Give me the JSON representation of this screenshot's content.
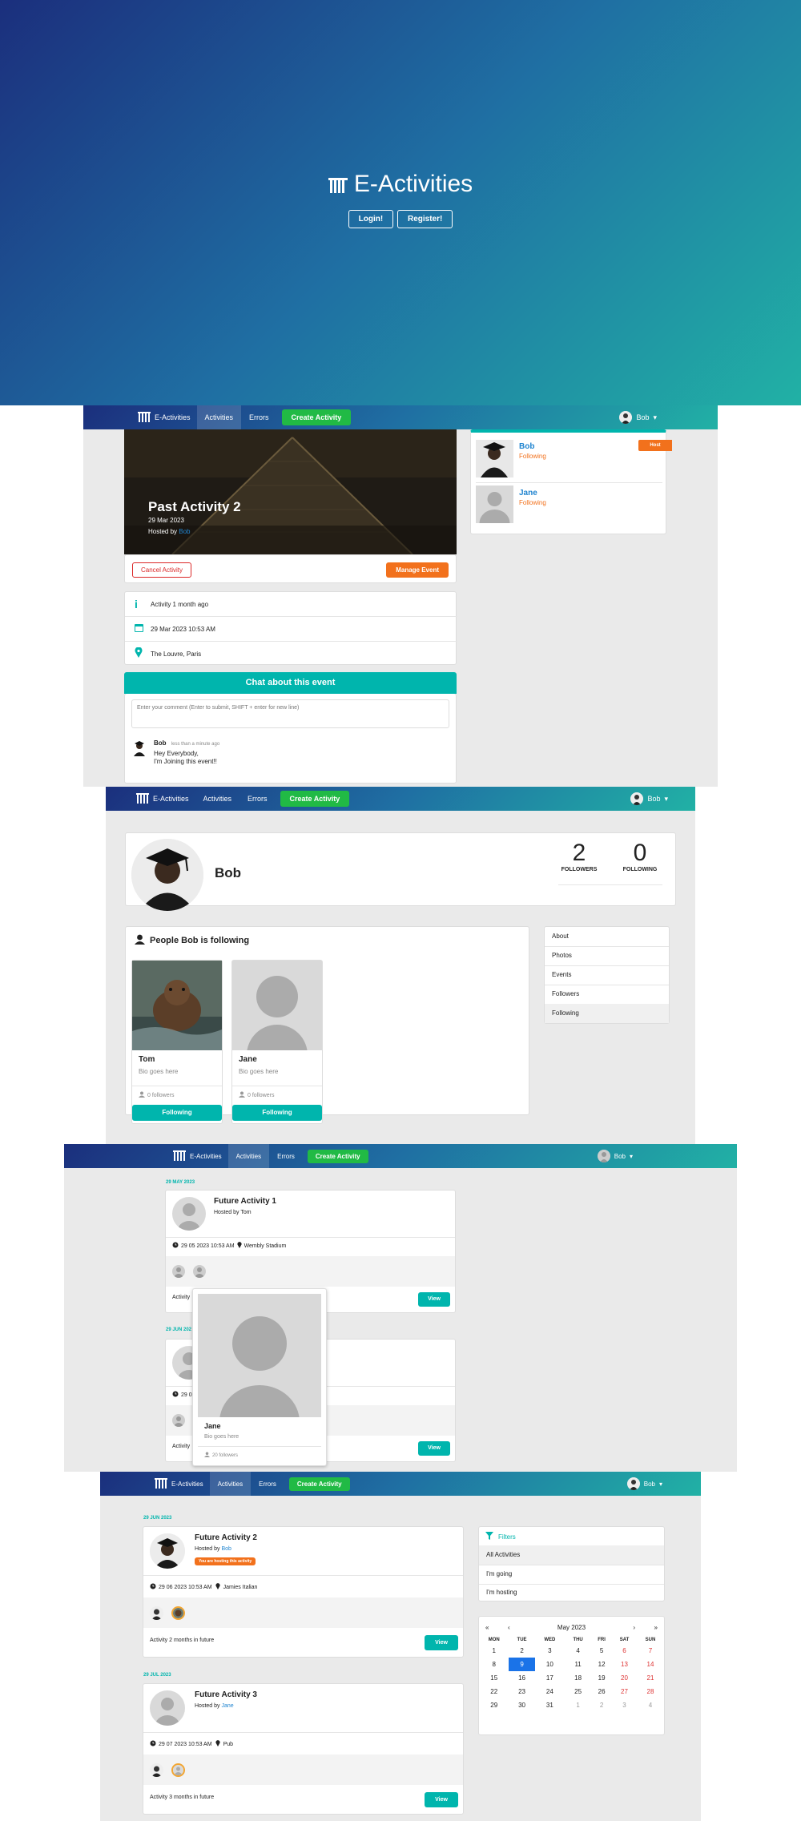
{
  "hero": {
    "title": "E-Activities",
    "login_label": "Login!",
    "register_label": "Register!"
  },
  "nav": {
    "brand": "E-Activities",
    "activities": "Activities",
    "errors": "Errors",
    "create": "Create Activity",
    "user": "Bob"
  },
  "details": {
    "title": "Past Activity 2",
    "date": "29 Mar 2023",
    "hosted_prefix": "Hosted by ",
    "host": "Bob",
    "cancel_label": "Cancel Activity",
    "manage_label": "Manage Event",
    "info": [
      {
        "icon": "info-icon",
        "text": "Activity 1 month ago"
      },
      {
        "icon": "calendar-icon",
        "text": "29 Mar 2023 10:53 AM"
      },
      {
        "icon": "marker-icon",
        "text": "The Louvre, Paris"
      }
    ],
    "chat_title": "Chat about this event",
    "chat_placeholder": "Enter your comment (Enter to submit, SHIFT + enter for new line)",
    "comment": {
      "author": "Bob",
      "time": "less than a minute ago",
      "line1": "Hey Everybody,",
      "line2": "I'm Joining this event!!"
    },
    "attendees": [
      {
        "name": "Bob",
        "status": "Following",
        "badge": "Host"
      },
      {
        "name": "Jane",
        "status": "Following"
      }
    ]
  },
  "profile": {
    "name": "Bob",
    "followers_count": "2",
    "followers_label": "FOLLOWERS",
    "following_count": "0",
    "following_label": "FOLLOWING",
    "section_title": "People Bob is following",
    "people": [
      {
        "name": "Tom",
        "bio": "Bio goes here",
        "followers": "0 followers",
        "button": "Following"
      },
      {
        "name": "Jane",
        "bio": "Bio goes here",
        "followers": "0 followers",
        "button": "Following"
      }
    ],
    "menu": [
      "About",
      "Photos",
      "Events",
      "Followers",
      "Following"
    ]
  },
  "list1": {
    "date1": "29 MAY 2023",
    "title1": "Future Activity 1",
    "hosted1": "Hosted by Tom",
    "when1": "29 05 2023 10:53 AM",
    "venue1": "Wembly Stadium",
    "desc1": "Activity",
    "view": "View",
    "date2": "29 JUN 202",
    "popup": {
      "name": "Jane",
      "bio": "Bio goes here",
      "followers": "20 followers"
    },
    "desc2": "Activity",
    "when2": "29 0"
  },
  "list2": {
    "date1": "29 JUN 2023",
    "title1": "Future Activity 2",
    "hosted_prefix": "Hosted by ",
    "host1": "Bob",
    "hosting_badge": "You are hosting this activity",
    "when1": "29 06 2023 10:53 AM",
    "venue1": "Jamies Italian",
    "desc1": "Activity 2 months in future",
    "view": "View",
    "date2": "29 JUL 2023",
    "title2": "Future Activity 3",
    "host2": "Jane",
    "when2": "29 07 2023 10:53 AM",
    "venue2": "Pub",
    "desc2": "Activity 3 months in future",
    "filters_title": "Filters",
    "filters": [
      "All Activities",
      "I'm going",
      "I'm hosting"
    ],
    "calendar": {
      "month": "May 2023",
      "nav": [
        "«",
        "‹",
        "›",
        "»"
      ],
      "days": [
        "MON",
        "TUE",
        "WED",
        "THU",
        "FRI",
        "SAT",
        "SUN"
      ],
      "weeks": [
        [
          "1",
          "2",
          "3",
          "4",
          "5",
          "6",
          "7"
        ],
        [
          "8",
          "9",
          "10",
          "11",
          "12",
          "13",
          "14"
        ],
        [
          "15",
          "16",
          "17",
          "18",
          "19",
          "20",
          "21"
        ],
        [
          "22",
          "23",
          "24",
          "25",
          "26",
          "27",
          "28"
        ],
        [
          "29",
          "30",
          "31",
          "1",
          "2",
          "3",
          "4"
        ]
      ],
      "selected": "9"
    }
  },
  "colors": {
    "teal": "#00b5ad",
    "orange": "#f2711c",
    "green": "#21ba45",
    "blue": "#2185d0"
  }
}
